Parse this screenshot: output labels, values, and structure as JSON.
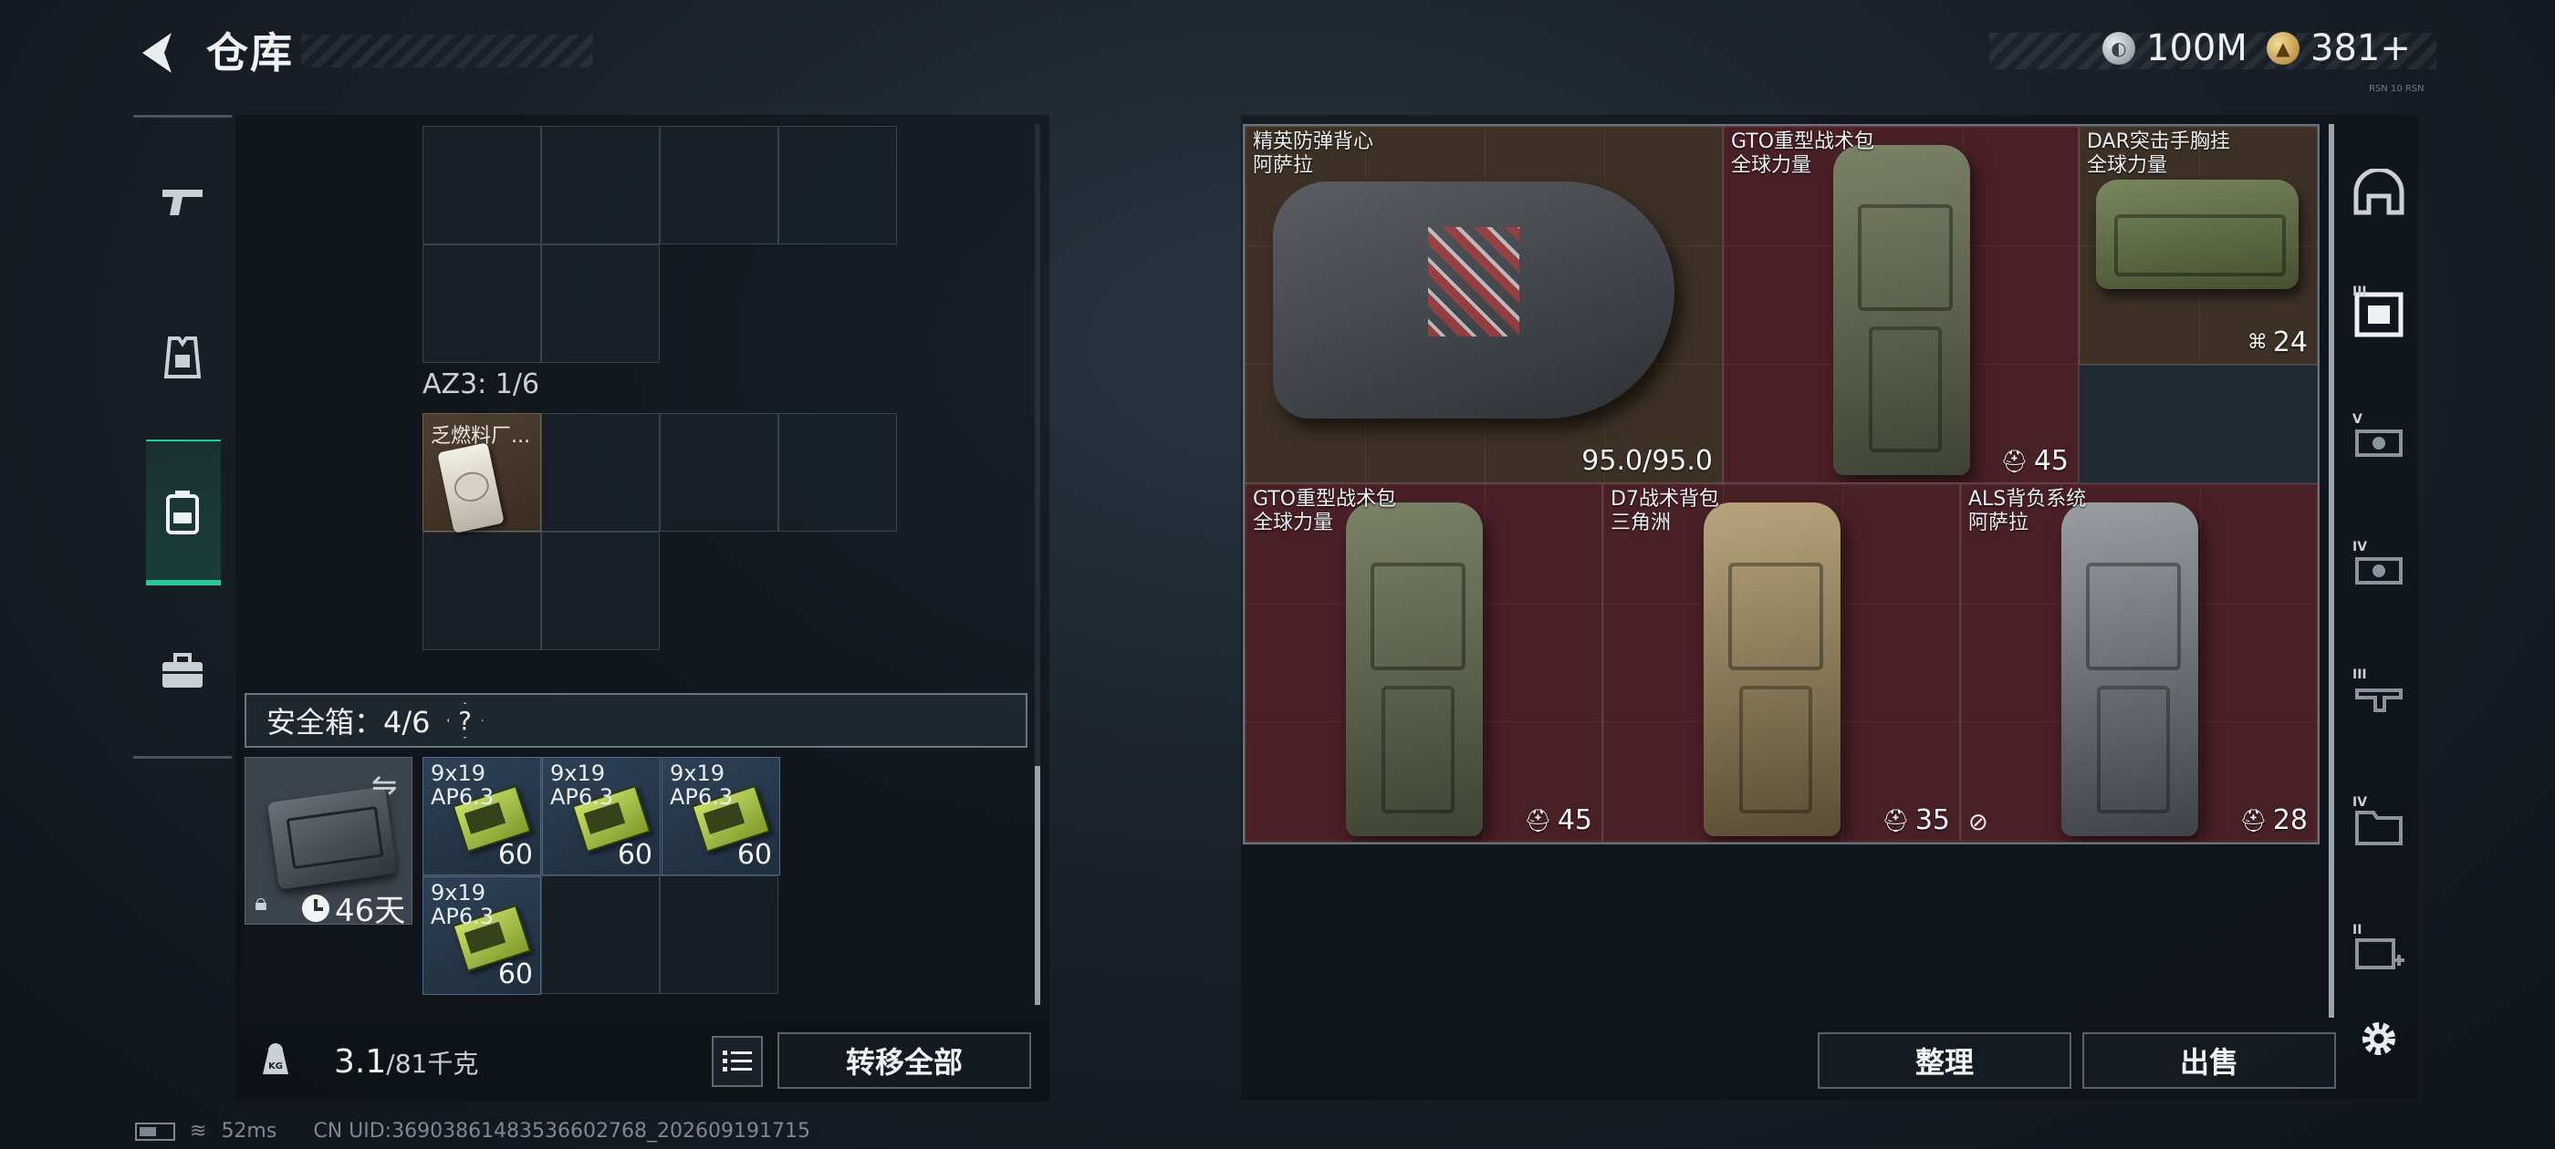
{
  "header": {
    "title": "仓库",
    "currency_silver": "100M",
    "currency_gold": "381+",
    "version_tag": "RSN 10 RSN"
  },
  "left_nav": {
    "items": [
      {
        "name": "weapons-tab",
        "icon": "pistol-icon"
      },
      {
        "name": "armor-tab",
        "icon": "chest-rig-icon"
      },
      {
        "name": "backpack-tab",
        "icon": "backpack-icon",
        "active": true
      },
      {
        "name": "toolbox-tab",
        "icon": "toolbox-icon"
      }
    ]
  },
  "storage": {
    "az3_label": "AZ3: 1/6",
    "fuel_item_label": "乏燃料厂..."
  },
  "safe_box": {
    "label": "安全箱：4/6",
    "help": "?",
    "timer": "46天",
    "ammo": [
      {
        "name": "9x19\nAP6.3",
        "qty": "60"
      },
      {
        "name": "9x19\nAP6.3",
        "qty": "60"
      },
      {
        "name": "9x19\nAP6.3",
        "qty": "60"
      },
      {
        "name": "9x19\nAP6.3",
        "qty": "60"
      }
    ]
  },
  "bottom_left": {
    "weight_current": "3.1",
    "weight_max": "/81千克",
    "transfer_all": "转移全部"
  },
  "status": {
    "ping": "52ms",
    "uid": "CN UID:3690386148353660​2768_202609191715"
  },
  "gear": [
    {
      "line1": "精英防弹背心",
      "line2": "阿萨拉",
      "value": "95.0/95.0",
      "tint": "brown"
    },
    {
      "line1": "GTO重型战术包",
      "line2": "全球力量",
      "value": "45",
      "tint": "red"
    },
    {
      "line1": "DAR突击手胸挂",
      "line2": "全球力量",
      "value": "24",
      "tint": "brown"
    },
    {
      "line1": "GTO重型战术包",
      "line2": "全球力量",
      "value": "45",
      "tint": "red"
    },
    {
      "line1": "D7战术背包",
      "line2": "三角洲",
      "value": "35",
      "tint": "red"
    },
    {
      "line1": "ALS背负系统",
      "line2": "阿萨拉",
      "value": "28",
      "tint": "red"
    }
  ],
  "right_actions": {
    "sort": "整理",
    "sell": "出售"
  },
  "filters": [
    {
      "name": "helmet-filter",
      "level": ""
    },
    {
      "name": "armor-filter",
      "level": "III"
    },
    {
      "name": "tier5-filter",
      "level": "V"
    },
    {
      "name": "tier4-filter",
      "level": "IV"
    },
    {
      "name": "tier3-filter",
      "level": "III"
    },
    {
      "name": "tier4-bag-filter",
      "level": "IV"
    },
    {
      "name": "tier2-add-filter",
      "level": "II"
    }
  ],
  "colors": {
    "accent_green": "#2cc796",
    "tile_brown": "#3d3125",
    "tile_red": "#4a2027"
  }
}
